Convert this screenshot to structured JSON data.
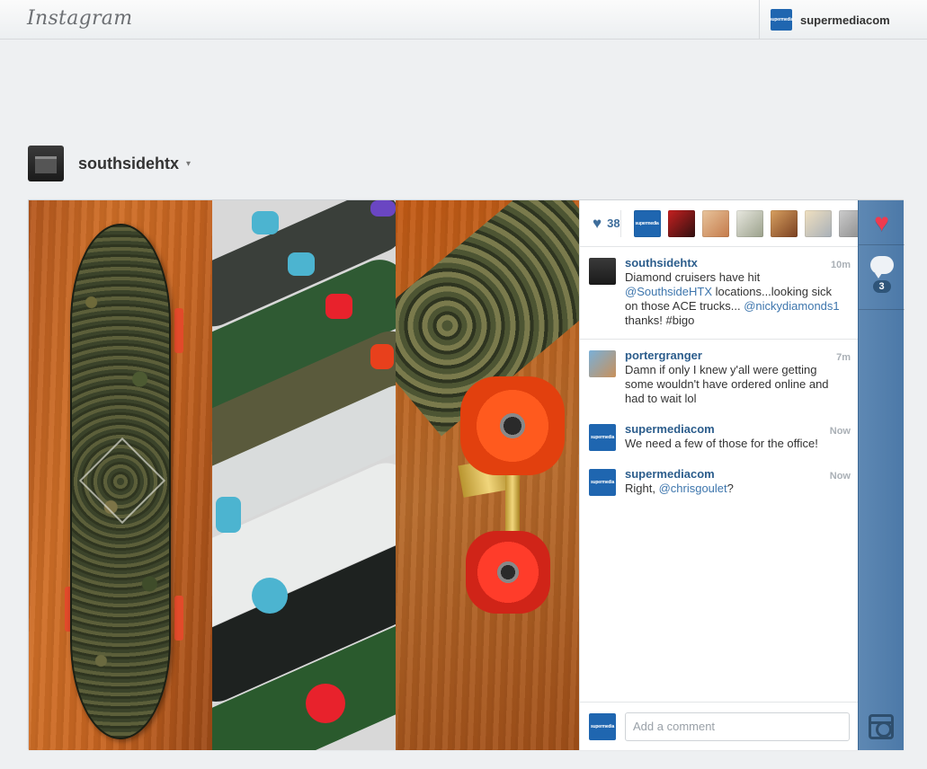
{
  "topbar": {
    "logo": "Instagram",
    "account_name": "supermediacom",
    "account_avatar_text": "supermedia"
  },
  "owner": {
    "username": "southsidehtx",
    "caret": "▾"
  },
  "likes": {
    "count": "38"
  },
  "comments": [
    {
      "user": "southsidehtx",
      "time": "10m",
      "parts": [
        {
          "t": "Diamond cruisers have hit "
        },
        {
          "t": "@SouthsideHTX",
          "m": true
        },
        {
          "t": " locations...looking sick on those ACE trucks... "
        },
        {
          "t": "@nickydiamonds1",
          "m": true
        },
        {
          "t": " thanks! #bigo"
        }
      ]
    },
    {
      "user": "portergranger",
      "time": "7m",
      "parts": [
        {
          "t": "Damn if only I knew y'all were getting some wouldn't have ordered online and had to wait lol"
        }
      ]
    },
    {
      "user": "supermediacom",
      "time": "Now",
      "parts": [
        {
          "t": "We need a few of those for the office!"
        }
      ]
    },
    {
      "user": "supermediacom",
      "time": "Now",
      "parts": [
        {
          "t": "Right, "
        },
        {
          "t": "@chrisgoulet",
          "m": true
        },
        {
          "t": "?"
        }
      ]
    }
  ],
  "add_comment": {
    "placeholder": "Add a comment"
  },
  "rail": {
    "comment_count": "3"
  },
  "colors": {
    "link": "#2c5d8c",
    "rail": "#4c79a8",
    "heart": "#ef3b4f"
  }
}
